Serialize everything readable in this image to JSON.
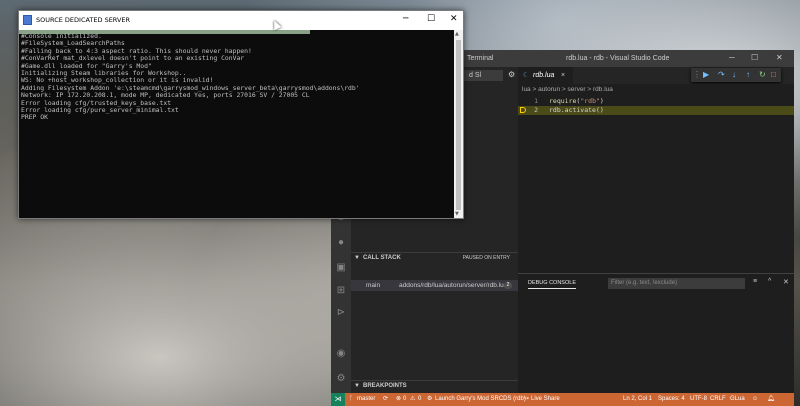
{
  "console": {
    "title": "SOURCE DEDICATED SERVER",
    "lines": [
      "#Console initialized.",
      "#FileSystem_LoadSearchPaths",
      "#Falling back to 4:3 aspect ratio. This should never happen!",
      "#ConVarRef mat_dxlevel doesn't point to an existing ConVar",
      "#Game.dll loaded for \"Garry's Mod\"",
      "Initializing Steam libraries for Workshop..",
      "WS: No +host_workshop_collection or it is invalid!",
      "Adding Filesystem Addon 'e:\\steamcmd\\garrysmod_windows_server_beta\\garrysmod\\addons\\rdb'",
      "Network: IP 172.20.208.1, mode MP, dedicated Yes, ports 27016 SV / 27005 CL",
      "Error loading cfg/trusted_keys_base.txt",
      "Error loading cfg/pure_server_minimal.txt",
      "PREP OK"
    ]
  },
  "vscode": {
    "menu_terminal": "Terminal",
    "window_title": "rdb.lua - rdb - Visual Studio Code",
    "debug_config_label": "d Sl",
    "tab_label": "rdb.lua",
    "breadcrumb": "lua  >  autorun  >  server  >  rdb.lua",
    "code": [
      {
        "n": "1",
        "fn": "require",
        "arg": "\"rdb\"",
        "tail": ")"
      },
      {
        "n": "2",
        "text": "rdb.activate()"
      }
    ],
    "call_stack": {
      "header": "CALL STACK",
      "status": "PAUSED ON ENTRY",
      "frame_name": "main",
      "frame_file": "addons/rdb/lua/autorun/server/rdb.lua",
      "frame_line": "2"
    },
    "breakpoints_header": "BREAKPOINTS",
    "panel": {
      "tab": "DEBUG CONSOLE",
      "filter_placeholder": "Filter (e.g. text, !exclude)"
    },
    "status": {
      "branch": "master",
      "errors": "0",
      "warnings": "0",
      "launch": "Launch Garry's Mod SRCDS (rdb)",
      "live_share": "Live Share",
      "position": "Ln 2, Col 1",
      "spaces": "Spaces: 4",
      "encoding": "UTF-8",
      "eol": "CRLF",
      "language": "GLua"
    },
    "colors": {
      "statusbar": "#cc6633",
      "remote": "#16825d",
      "current_line": "#4b4b18"
    }
  }
}
